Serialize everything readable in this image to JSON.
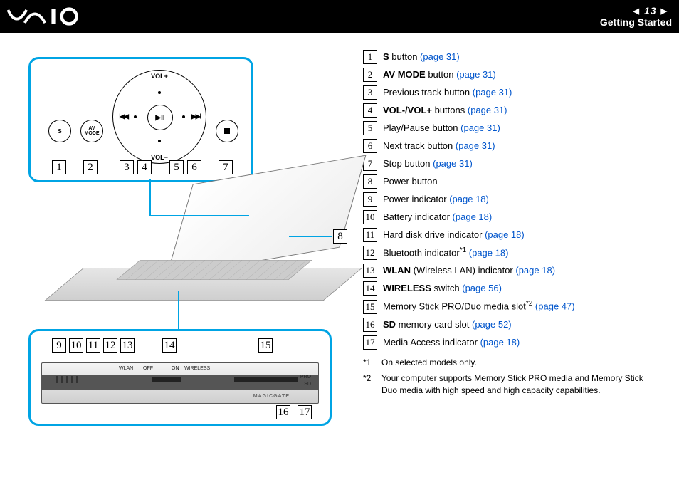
{
  "header": {
    "page_number": "13",
    "section_title": "Getting Started"
  },
  "diagram": {
    "vol_plus": "VOL+",
    "vol_minus": "VOL−",
    "s_label": "S",
    "av_label": "AV\nMODE",
    "play_label": "▶II",
    "prev_label": "I◀◀",
    "next_label": "▶▶I",
    "wlan_label": "WLAN",
    "wireless_label": "WIRELESS",
    "off_label": "OFF",
    "on_label": "ON",
    "pro_label": "PRO",
    "sd_label": "SD",
    "magicgate": "MAGICGATE"
  },
  "callouts": {
    "top_row": [
      "1",
      "2",
      "3",
      "4",
      "5",
      "6",
      "7"
    ],
    "mid": "8",
    "bottom_row1": [
      "9",
      "10",
      "11",
      "12",
      "13",
      "14",
      "15"
    ],
    "bottom_row2": [
      "16",
      "17"
    ]
  },
  "legend": [
    {
      "num": "1",
      "bold": "S",
      "text": " button ",
      "link": "(page 31)"
    },
    {
      "num": "2",
      "bold": "AV MODE",
      "text": " button ",
      "link": "(page 31)"
    },
    {
      "num": "3",
      "text": "Previous track button ",
      "link": "(page 31)"
    },
    {
      "num": "4",
      "bold": "VOL-/VOL+",
      "text": " buttons ",
      "link": "(page 31)"
    },
    {
      "num": "5",
      "text": "Play/Pause button ",
      "link": "(page 31)"
    },
    {
      "num": "6",
      "text": "Next track button ",
      "link": "(page 31)"
    },
    {
      "num": "7",
      "text": "Stop button ",
      "link": "(page 31)"
    },
    {
      "num": "8",
      "text": "Power button"
    },
    {
      "num": "9",
      "text": "Power indicator ",
      "link": "(page 18)"
    },
    {
      "num": "10",
      "text": "Battery indicator ",
      "link": "(page 18)"
    },
    {
      "num": "11",
      "text": "Hard disk drive indicator ",
      "link": "(page 18)"
    },
    {
      "num": "12",
      "text": "Bluetooth indicator",
      "sup": "*1",
      "post": " ",
      "link": "(page 18)"
    },
    {
      "num": "13",
      "bold": "WLAN",
      "text": " (Wireless LAN) indicator ",
      "link": "(page 18)"
    },
    {
      "num": "14",
      "bold": "WIRELESS",
      "text": " switch ",
      "link": "(page 56)"
    },
    {
      "num": "15",
      "text": "Memory Stick PRO/Duo media slot",
      "sup": "*2",
      "post": " ",
      "link": "(page 47)"
    },
    {
      "num": "16",
      "bold": "SD",
      "text": " memory card slot ",
      "link": "(page 52)"
    },
    {
      "num": "17",
      "text": "Media Access indicator ",
      "link": "(page 18)"
    }
  ],
  "footnotes": [
    {
      "mark": "*1",
      "text": "On selected models only."
    },
    {
      "mark": "*2",
      "text": "Your computer supports Memory Stick PRO media and Memory Stick Duo media with high speed and high capacity capabilities."
    }
  ]
}
